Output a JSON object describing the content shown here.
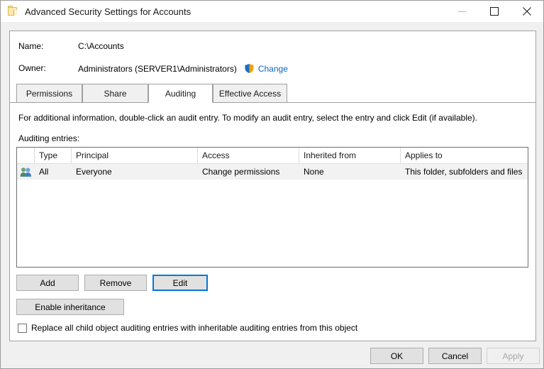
{
  "window": {
    "title": "Advanced Security Settings for Accounts",
    "icon": "folder-icon",
    "controls": {
      "minimize": "minimize-icon",
      "maximize": "maximize-icon",
      "close": "close-icon"
    }
  },
  "header": {
    "name_label": "Name:",
    "name_value": "C:\\Accounts",
    "owner_label": "Owner:",
    "owner_value": "Administrators (SERVER1\\Administrators)",
    "change_link": "Change",
    "shield_icon": "uac-shield-icon"
  },
  "tabs": [
    {
      "label": "Permissions",
      "selected": false
    },
    {
      "label": "Share",
      "selected": false
    },
    {
      "label": "Auditing",
      "selected": true
    },
    {
      "label": "Effective Access",
      "selected": false
    }
  ],
  "main": {
    "instructions": "For additional information, double-click an audit entry. To modify an audit entry, select the entry and click Edit (if available).",
    "entries_label": "Auditing entries:"
  },
  "list": {
    "columns": [
      "Type",
      "Principal",
      "Access",
      "Inherited from",
      "Applies to"
    ],
    "rows": [
      {
        "icon": "users-icon",
        "type": "All",
        "principal": "Everyone",
        "access": "Change permissions",
        "inherited_from": "None",
        "applies_to": "This folder, subfolders and files",
        "selected": true
      }
    ]
  },
  "buttons": {
    "add": "Add",
    "remove": "Remove",
    "edit": "Edit",
    "enable_inheritance": "Enable inheritance"
  },
  "checkbox": {
    "replace_label": "Replace all child object auditing entries with inheritable auditing entries from this object",
    "checked": false
  },
  "footer": {
    "ok": "OK",
    "cancel": "Cancel",
    "apply": "Apply"
  },
  "colors": {
    "accent": "#0078d7",
    "link": "#0866c6",
    "window_bg": "#f0f0f0",
    "card_bg": "#ffffff",
    "selected_row": "#f2f2f2"
  }
}
